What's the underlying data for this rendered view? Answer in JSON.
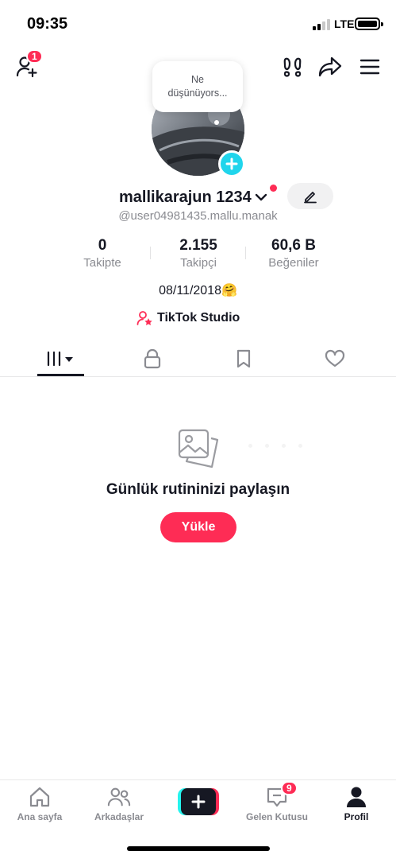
{
  "status_bar": {
    "time": "09:35",
    "network": "LTE"
  },
  "header": {
    "friend_requests_badge": "1"
  },
  "profile": {
    "thought_bubble_line1": "Ne",
    "thought_bubble_line2": "düşünüyors...",
    "display_name": "mallikarajun 1234",
    "username": "@user04981435.mallu.manak",
    "bio": "08/11/2018🤗",
    "studio_link": "TikTok Studio"
  },
  "stats": [
    {
      "value": "0",
      "label": "Takipte"
    },
    {
      "value": "2.155",
      "label": "Takipçi"
    },
    {
      "value": "60,6 B",
      "label": "Beğeniler"
    }
  ],
  "tabs": [
    {
      "icon": "grid-icon"
    },
    {
      "icon": "lock-icon"
    },
    {
      "icon": "bookmark-icon"
    },
    {
      "icon": "heart-icon"
    }
  ],
  "empty_state": {
    "title": "Günlük rutininizi paylaşın",
    "button": "Yükle"
  },
  "bottom_nav": {
    "home": "Ana sayfa",
    "friends": "Arkadaşlar",
    "inbox": "Gelen Kutusu",
    "inbox_badge": "9",
    "profile": "Profil"
  },
  "colors": {
    "accent": "#fe2c55",
    "cyan": "#20d5ec",
    "text": "#161823",
    "muted": "#8a8b91"
  }
}
